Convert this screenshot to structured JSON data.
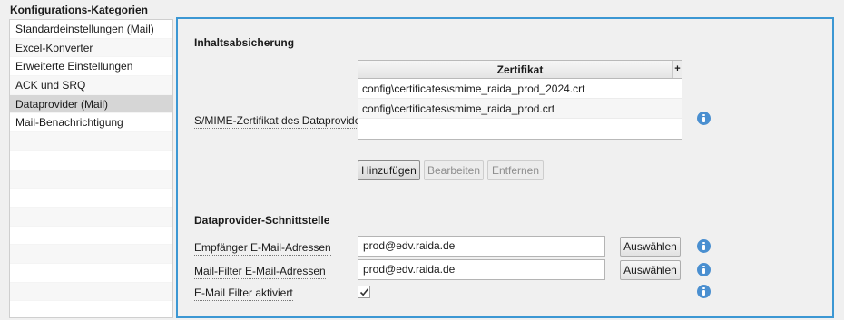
{
  "header": {
    "title": "Konfigurations-Kategorien"
  },
  "sidebar": {
    "items": [
      {
        "label": "Standardeinstellungen (Mail)",
        "selected": false
      },
      {
        "label": "Excel-Konverter",
        "selected": false
      },
      {
        "label": "Erweiterte Einstellungen",
        "selected": false
      },
      {
        "label": "ACK und SRQ",
        "selected": false
      },
      {
        "label": "Dataprovider (Mail)",
        "selected": true
      },
      {
        "label": "Mail-Benachrichtigung",
        "selected": false
      }
    ]
  },
  "content_security": {
    "title": "Inhaltsabsicherung",
    "smime_label": "S/MIME-Zertifikat des Dataproviders",
    "table": {
      "column": "Zertifikat",
      "add_icon": "+",
      "rows": [
        "config\\certificates\\smime_raida_prod_2024.crt",
        "config\\certificates\\smime_raida_prod.crt"
      ]
    },
    "buttons": {
      "add": "Hinzufügen",
      "edit": "Bearbeiten",
      "remove": "Entfernen"
    }
  },
  "interface": {
    "title": "Dataprovider-Schnittstelle",
    "recipient": {
      "label": "Empfänger E-Mail-Adressen",
      "value": "prod@edv.raida.de",
      "button": "Auswählen"
    },
    "filter": {
      "label": "Mail-Filter E-Mail-Adressen",
      "value": "prod@edv.raida.de",
      "button": "Auswählen"
    },
    "filter_enabled": {
      "label": "E-Mail Filter aktiviert",
      "checked": true
    }
  },
  "colors": {
    "panel_border": "#3c97d3",
    "info_icon": "#4a8fd0",
    "selected_row": "#d6d6d6"
  }
}
